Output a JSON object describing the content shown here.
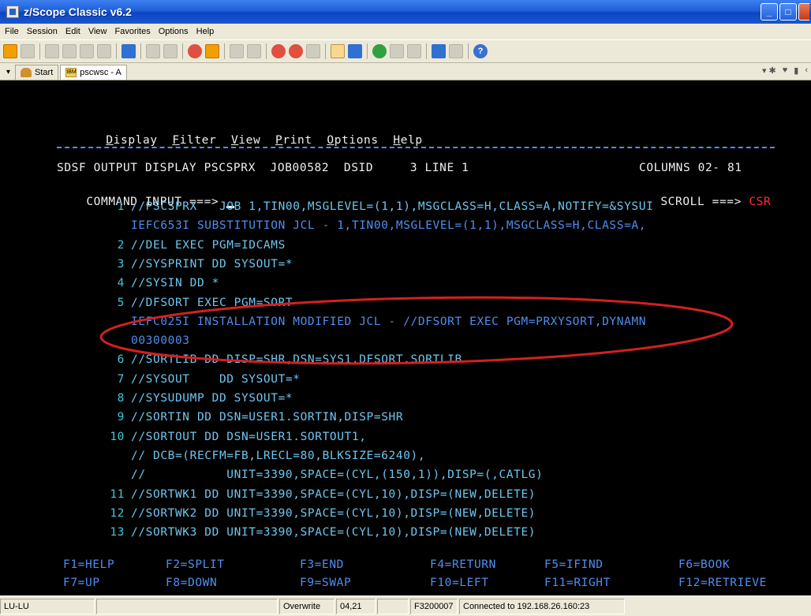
{
  "window": {
    "title": "z/Scope Classic v6.2"
  },
  "menubar": {
    "items": [
      "File",
      "Session",
      "Edit",
      "View",
      "Favorites",
      "Options",
      "Help"
    ]
  },
  "tabs": [
    {
      "label": "Start",
      "icon": "start-icon"
    },
    {
      "label": "pscwsc - A",
      "icon": "terminal-session-icon",
      "active": true
    }
  ],
  "terminal": {
    "menu": [
      {
        "label": "Display",
        "hotkey": "D"
      },
      {
        "label": "Filter",
        "hotkey": "F"
      },
      {
        "label": "View",
        "hotkey": "V"
      },
      {
        "label": "Print",
        "hotkey": "P"
      },
      {
        "label": "Options",
        "hotkey": "O"
      },
      {
        "label": "Help",
        "hotkey": "H"
      }
    ],
    "header": {
      "title": "SDSF OUTPUT DISPLAY PSCSPRX  JOB00582  DSID     3 LINE 1",
      "columns": "COLUMNS 02- 81",
      "command_label": "COMMAND INPUT ===>",
      "scroll_label": "SCROLL ===>",
      "scroll_value": "CSR"
    },
    "lines": [
      {
        "num": "1",
        "text": "//PSCSPRX   JOB 1,TIN00,MSGLEVEL=(1,1),MSGCLASS=H,CLASS=A,NOTIFY=&SYSUI",
        "color": "cyan"
      },
      {
        "num": "",
        "text": "IEFC653I SUBSTITUTION JCL - 1,TIN00,MSGLEVEL=(1,1),MSGCLASS=H,CLASS=A,",
        "color": "blue"
      },
      {
        "num": "2",
        "text": "//DEL EXEC PGM=IDCAMS",
        "color": "cyan"
      },
      {
        "num": "3",
        "text": "//SYSPRINT DD SYSOUT=*",
        "color": "cyan"
      },
      {
        "num": "4",
        "text": "//SYSIN DD *",
        "color": "cyan"
      },
      {
        "num": "5",
        "text": "//DFSORT EXEC PGM=SORT",
        "color": "cyan"
      },
      {
        "num": "",
        "text": "IEFC025I INSTALLATION MODIFIED JCL - //DFSORT EXEC PGM=PRXYSORT,DYNAMN",
        "color": "blue"
      },
      {
        "num": "",
        "text": "00300003",
        "color": "blue"
      },
      {
        "num": "6",
        "text": "//SORTLIB DD DISP=SHR,DSN=SYS1.DFSORT.SORTLIB",
        "color": "cyan"
      },
      {
        "num": "7",
        "text": "//SYSOUT    DD SYSOUT=*",
        "color": "cyan"
      },
      {
        "num": "8",
        "text": "//SYSUDUMP DD SYSOUT=*",
        "color": "cyan"
      },
      {
        "num": "9",
        "text": "//SORTIN DD DSN=USER1.SORTIN,DISP=SHR",
        "color": "cyan"
      },
      {
        "num": "10",
        "text": "//SORTOUT DD DSN=USER1.SORTOUT1,",
        "color": "cyan"
      },
      {
        "num": "",
        "text": "// DCB=(RECFM=FB,LRECL=80,BLKSIZE=6240),",
        "color": "cyan"
      },
      {
        "num": "",
        "text": "//           UNIT=3390,SPACE=(CYL,(150,1)),DISP=(,CATLG)",
        "color": "cyan"
      },
      {
        "num": "11",
        "text": "//SORTWK1 DD UNIT=3390,SPACE=(CYL,10),DISP=(NEW,DELETE)",
        "color": "cyan"
      },
      {
        "num": "12",
        "text": "//SORTWK2 DD UNIT=3390,SPACE=(CYL,10),DISP=(NEW,DELETE)",
        "color": "cyan"
      },
      {
        "num": "13",
        "text": "//SORTWK3 DD UNIT=3390,SPACE=(CYL,10),DISP=(NEW,DELETE)",
        "color": "cyan"
      }
    ],
    "fkeys_row1": [
      "F1=HELP",
      "F2=SPLIT",
      "F3=END",
      "F4=RETURN",
      "F5=IFIND",
      "F6=BOOK"
    ],
    "fkeys_row2": [
      "F7=UP",
      "F8=DOWN",
      "F9=SWAP",
      "F10=LEFT",
      "F11=RIGHT",
      "F12=RETRIEVE"
    ]
  },
  "statusbar": {
    "mode": "LU-LU",
    "insert_mode": "Overwrite",
    "cursor_pos": "04,21",
    "terminal_type": "F3200007",
    "connection": "Connected to 192.168.26.160:23"
  },
  "colors": {
    "annotation_ellipse": "#d42020",
    "terminal_bg": "#000000"
  }
}
